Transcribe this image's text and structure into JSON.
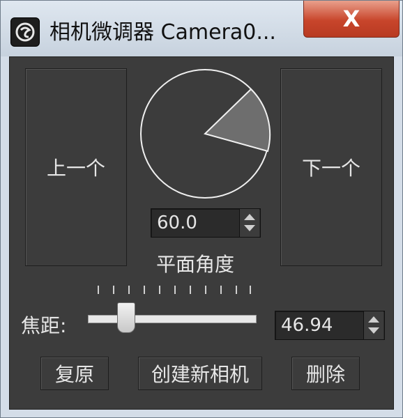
{
  "window": {
    "title": "相机微调器  Camera0...",
    "close_label": "X"
  },
  "nav": {
    "prev_label": "上一个",
    "next_label": "下一个"
  },
  "dial": {
    "angle_value": "60.0",
    "angle_label": "平面角度"
  },
  "focus": {
    "label": "焦距:",
    "value": "46.94",
    "slider_position_fraction": 0.25
  },
  "buttons": {
    "reset": "复原",
    "create_camera": "创建新相机",
    "delete": "删除"
  },
  "icons": {
    "app": "3dsmax-logo-icon",
    "close": "close-icon"
  },
  "colors": {
    "panel_bg": "#3c3c3c",
    "close_red": "#c8452b",
    "text": "#e6e6e6"
  }
}
